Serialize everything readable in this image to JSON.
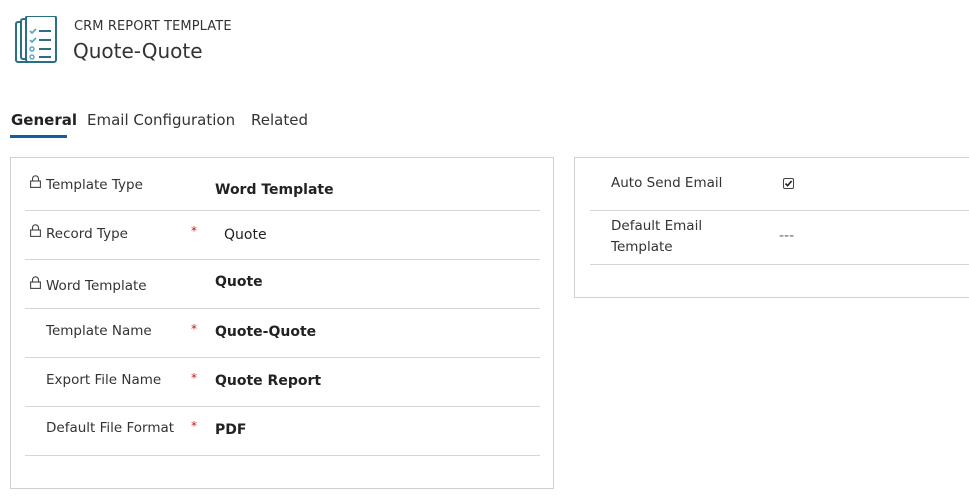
{
  "header": {
    "entity_type": "CRM REPORT TEMPLATE",
    "record_title": "Quote-Quote",
    "icon": "report-template-icon"
  },
  "tabs": [
    {
      "label": "General",
      "active": true
    },
    {
      "label": "Email Configuration",
      "active": false
    },
    {
      "label": "Related",
      "active": false
    }
  ],
  "general_fields": [
    {
      "label": "Template Type",
      "value": "Word Template",
      "locked": true,
      "required": false
    },
    {
      "label": "Record Type",
      "value": "Quote",
      "locked": true,
      "required": true
    },
    {
      "label": "Word Template",
      "value": "Quote",
      "locked": true,
      "required": false
    },
    {
      "label": "Template Name",
      "value": "Quote-Quote",
      "locked": false,
      "required": true
    },
    {
      "label": "Export File Name",
      "value": "Quote Report",
      "locked": false,
      "required": true
    },
    {
      "label": "Default File Format",
      "value": "PDF",
      "locked": false,
      "required": true
    }
  ],
  "email_fields": {
    "auto_send": {
      "label": "Auto Send Email",
      "checked": true
    },
    "default_template": {
      "label_line1": "Default Email",
      "label_line2": "Template",
      "value": "---"
    }
  },
  "required_marker": "*",
  "colors": {
    "accent": "#115ea3",
    "required": "#c8191d",
    "icon": "#1f6b82"
  }
}
